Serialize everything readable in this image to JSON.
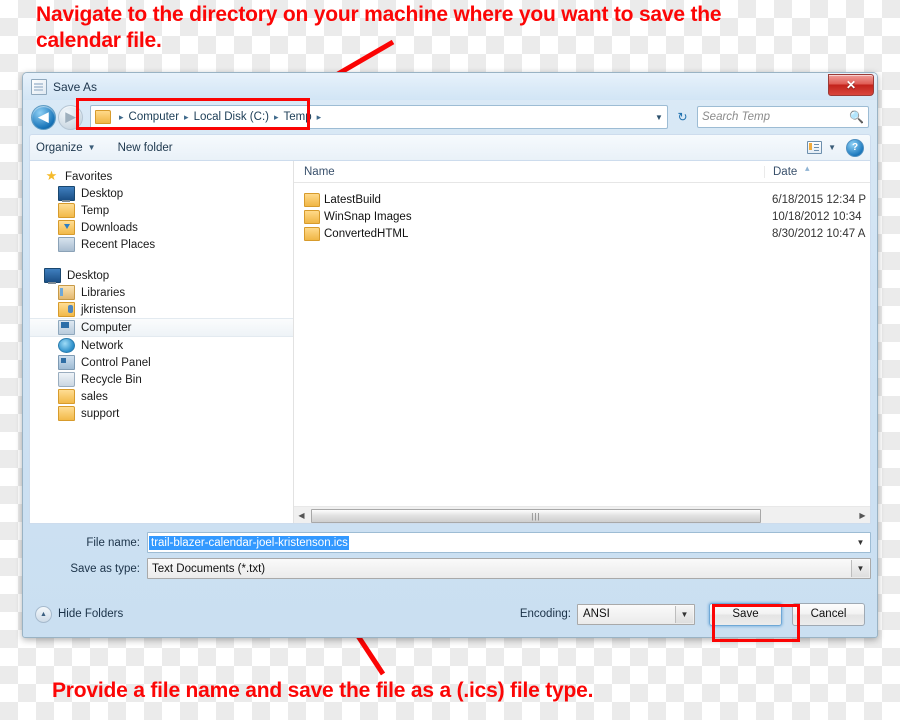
{
  "annotations": {
    "top": "Navigate to the directory on your machine where you want to save the calendar file.",
    "bottom": "Provide a file name and save the file as a (.ics) file type.",
    "color": "#fc0606"
  },
  "window": {
    "title": "Save As",
    "title_icon": "window-icon",
    "close_label": "✕"
  },
  "address_bar": {
    "back_icon": "◀",
    "forward_icon": "▶",
    "folder_icon": "folder-icon",
    "crumbs": [
      "Computer",
      "Local Disk (C:)",
      "Temp"
    ],
    "separator": "▸",
    "dropdown_icon": "▼",
    "refresh_icon": "↻"
  },
  "search": {
    "placeholder": "Search Temp",
    "icon": "🔍"
  },
  "command_bar": {
    "organize": "Organize",
    "organize_caret": "▼",
    "new_folder": "New folder",
    "view_caret": "▼",
    "help_label": "?"
  },
  "sidebar": {
    "groups": [
      {
        "header": {
          "label": "Favorites",
          "icon": "star-icon"
        },
        "items": [
          {
            "label": "Desktop",
            "icon": "desktop-icon"
          },
          {
            "label": "Temp",
            "icon": "folder-icon"
          },
          {
            "label": "Downloads",
            "icon": "downloads-icon"
          },
          {
            "label": "Recent Places",
            "icon": "recent-places-icon"
          }
        ]
      },
      {
        "header": {
          "label": "Desktop",
          "icon": "desktop-icon"
        },
        "items": [
          {
            "label": "Libraries",
            "icon": "libraries-icon",
            "selected": false
          },
          {
            "label": "jkristenson",
            "icon": "user-folder-icon",
            "selected": false
          },
          {
            "label": "Computer",
            "icon": "computer-icon",
            "selected": true
          },
          {
            "label": "Network",
            "icon": "network-icon",
            "selected": false
          },
          {
            "label": "Control Panel",
            "icon": "control-panel-icon",
            "selected": false
          },
          {
            "label": "Recycle Bin",
            "icon": "recycle-bin-icon",
            "selected": false
          },
          {
            "label": "sales",
            "icon": "folder-icon",
            "selected": false
          },
          {
            "label": "support",
            "icon": "folder-icon",
            "selected": false
          }
        ]
      }
    ]
  },
  "file_list": {
    "columns": [
      "Name",
      "Date"
    ],
    "sort_caret": "▴",
    "rows": [
      {
        "name": "LatestBuild",
        "date": "6/18/2015 12:34 P",
        "icon": "folder-icon"
      },
      {
        "name": "WinSnap Images",
        "date": "10/18/2012 10:34",
        "icon": "folder-icon"
      },
      {
        "name": "ConvertedHTML",
        "date": "8/30/2012 10:47 A",
        "icon": "folder-icon"
      }
    ],
    "scroll_left_icon": "◀",
    "scroll_right_icon": "▶",
    "thumb_grip": "|||"
  },
  "form": {
    "file_name_label": "File name:",
    "file_name_value": "trail-blazer-calendar-joel-kristenson.ics",
    "save_as_type_label": "Save as type:",
    "save_as_type_value": "Text Documents (*.txt)",
    "dropdown_icon": "▼"
  },
  "footer": {
    "hide_folders_label": "Hide Folders",
    "hide_folders_icon": "▲",
    "encoding_label": "Encoding:",
    "encoding_value": "ANSI",
    "encoding_caret": "▼",
    "save_label": "Save",
    "cancel_label": "Cancel"
  }
}
